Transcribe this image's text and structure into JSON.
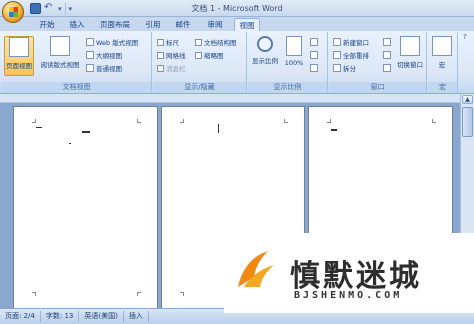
{
  "window": {
    "title": "文档 1 - Microsoft Word"
  },
  "quick_access": {
    "save_icon": "save-icon",
    "undo_icon": "undo-icon",
    "customize_icon": "customize-qat-icon"
  },
  "tabs": [
    {
      "label": "开始"
    },
    {
      "label": "插入"
    },
    {
      "label": "页面布局"
    },
    {
      "label": "引用"
    },
    {
      "label": "邮件"
    },
    {
      "label": "审阅"
    },
    {
      "label": "视图",
      "active": true
    }
  ],
  "ribbon": {
    "doc_views": {
      "group_label": "文档视图",
      "page_view": "页面视图",
      "reading_view": "阅读版式视图",
      "web_view": "Web 版式视图",
      "outline_view": "大纲视图",
      "draft_view": "普通视图"
    },
    "show_hide": {
      "group_label": "显示/隐藏",
      "ruler": "标尺",
      "gridlines": "网格线",
      "message_bar": "消息栏",
      "doc_map": "文档结构图",
      "thumbnails": "缩略图"
    },
    "zoom": {
      "group_label": "显示比例",
      "zoom_btn": "显示比例",
      "pct_btn": "100%"
    },
    "window": {
      "group_label": "窗口",
      "new_window": "新建窗口",
      "arrange_all": "全部重排",
      "split": "拆分",
      "switch_window": "切换窗口"
    },
    "macros": {
      "group_label": "宏",
      "macros_btn": "宏"
    }
  },
  "statusbar": {
    "page": "页面: 2/4",
    "words": "字数: 13",
    "language": "英语(美国)",
    "insert_mode": "插入"
  },
  "watermark": {
    "title": "慎默迷城",
    "url": "BJSHENMO.COM"
  },
  "colors": {
    "ribbon_bg": "#dbe7f7",
    "active_button": "#f8c55a",
    "doc_background": "#8aa7cf",
    "watermark_orange": "#f28a12"
  }
}
